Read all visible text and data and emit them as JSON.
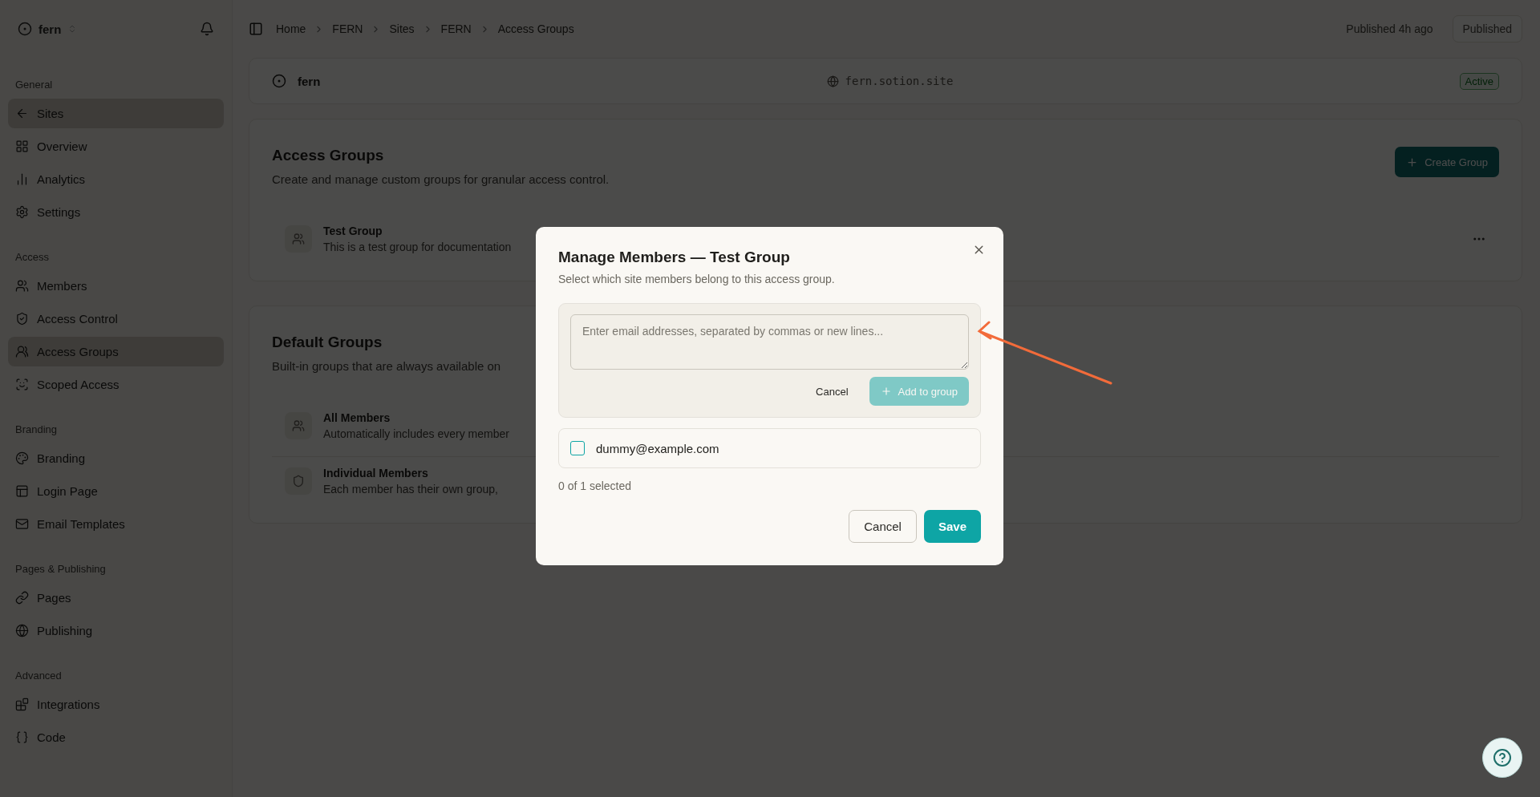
{
  "sidebar": {
    "site": "fern",
    "sections": [
      {
        "label": "General",
        "items": [
          {
            "label": "Sites",
            "kind": "back",
            "selected": true
          },
          {
            "label": "Overview",
            "kind": "grid",
            "selected": false
          },
          {
            "label": "Analytics",
            "kind": "chart",
            "selected": false
          },
          {
            "label": "Settings",
            "kind": "gear",
            "selected": false
          }
        ]
      },
      {
        "label": "Access",
        "items": [
          {
            "label": "Members",
            "kind": "users",
            "selected": false
          },
          {
            "label": "Access Control",
            "kind": "shield",
            "selected": false
          },
          {
            "label": "Access Groups",
            "kind": "group",
            "selected": true
          },
          {
            "label": "Scoped Access",
            "kind": "scan",
            "selected": false
          }
        ]
      },
      {
        "label": "Branding",
        "items": [
          {
            "label": "Branding",
            "kind": "palette",
            "selected": false
          },
          {
            "label": "Login Page",
            "kind": "layout",
            "selected": false
          },
          {
            "label": "Email Templates",
            "kind": "mail",
            "selected": false
          }
        ]
      },
      {
        "label": "Pages & Publishing",
        "items": [
          {
            "label": "Pages",
            "kind": "link",
            "selected": false
          },
          {
            "label": "Publishing",
            "kind": "globe",
            "selected": false
          }
        ]
      },
      {
        "label": "Advanced",
        "items": [
          {
            "label": "Integrations",
            "kind": "blocks",
            "selected": false
          },
          {
            "label": "Code",
            "kind": "braces",
            "selected": false
          }
        ]
      }
    ]
  },
  "breadcrumbs": [
    "Home",
    "FERN",
    "Sites",
    "FERN",
    "Access Groups"
  ],
  "publish_status": "Published 4h ago",
  "publish_button": {
    "label": "Published",
    "disabled": true
  },
  "site_card": {
    "name": "fern",
    "domain": "fern.sotion.site",
    "status": "Active"
  },
  "access_groups": {
    "title": "Access Groups",
    "description": "Create and manage custom groups for granular access control.",
    "create_button": "Create Group",
    "groups": [
      {
        "name": "Test Group",
        "description": "This is a test group for documentation",
        "kind": "group"
      }
    ]
  },
  "default_groups": {
    "title": "Default Groups",
    "description": "Built-in groups that are always available on",
    "groups": [
      {
        "name": "All Members",
        "description": "Automatically includes every member",
        "kind": "users"
      },
      {
        "name": "Individual Members",
        "description": "Each member has their own group,",
        "kind": "shield"
      }
    ]
  },
  "modal": {
    "title": "Manage Members — Test Group",
    "subtitle": "Select which site members belong to this access group.",
    "email_input": {
      "placeholder": "Enter email addresses, separated by commas or new lines..."
    },
    "inner_cancel": "Cancel",
    "add_button": {
      "label": "Add to group",
      "disabled": true
    },
    "members": [
      {
        "email": "dummy@example.com",
        "checked": false
      }
    ],
    "selection_count": "0 of 1 selected",
    "cancel": "Cancel",
    "save": "Save"
  }
}
